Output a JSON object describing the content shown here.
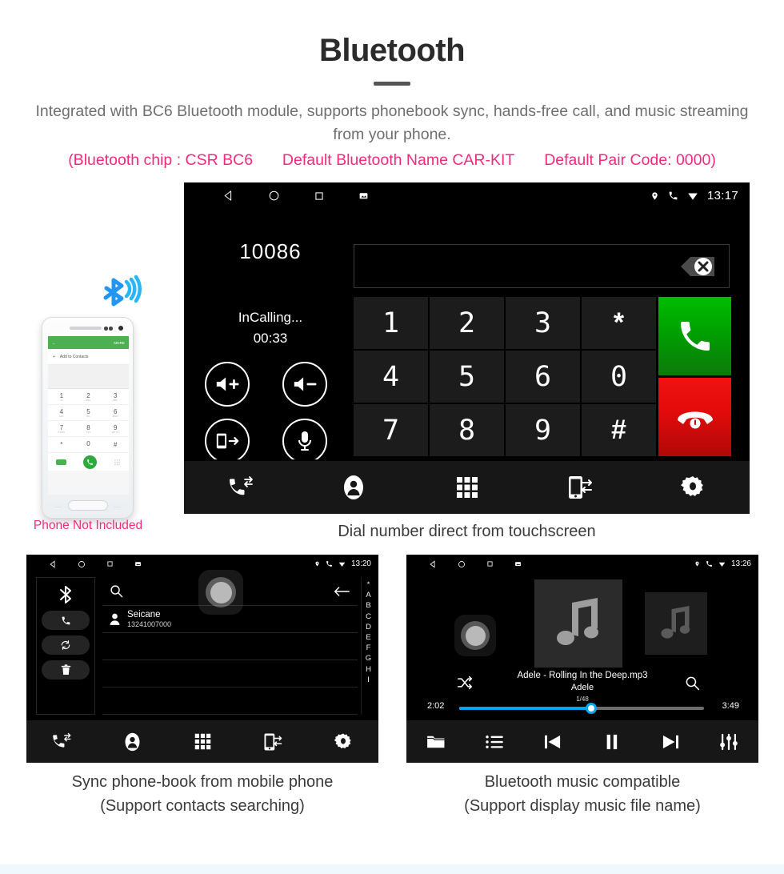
{
  "header": {
    "title": "Bluetooth",
    "subtitle": "Integrated with BC6 Bluetooth module, supports phonebook sync, hands-free call, and music streaming from your phone.",
    "spec_chip": "(Bluetooth chip : CSR BC6",
    "spec_name": "Default Bluetooth Name CAR-KIT",
    "spec_pair": "Default Pair Code: 0000)",
    "accent_pink": "#f5297e",
    "body_gray": "#6f6f6f"
  },
  "captions": {
    "main": "Dial number direct from touchscreen",
    "bottom_left_line1": "Sync phone-book from mobile phone",
    "bottom_left_line2": "(Support contacts searching)",
    "bottom_right_line1": "Bluetooth music compatible",
    "bottom_right_line2": "(Support display music file name)",
    "phone_note": "Phone Not Included"
  },
  "dialer_screen": {
    "status_bar": {
      "time": "13:17",
      "left_icons": [
        "back-icon",
        "home-icon",
        "recents-icon",
        "screenshot-icon"
      ],
      "right_icons": [
        "location-icon",
        "phone-icon",
        "wifi-icon"
      ]
    },
    "caller_number": "10086",
    "call_state": "InCalling...",
    "call_timer": "00:33",
    "input_value": "",
    "backspace_icon": "backspace-delete-icon",
    "call_controls": [
      {
        "name": "volume-up-button",
        "icon": "speaker-plus-icon"
      },
      {
        "name": "volume-down-button",
        "icon": "speaker-minus-icon"
      },
      {
        "name": "transfer-audio-button",
        "icon": "phone-transfer-icon"
      },
      {
        "name": "mute-microphone-button",
        "icon": "microphone-icon"
      }
    ],
    "keys": [
      "1",
      "2",
      "3",
      "*",
      "4",
      "5",
      "6",
      "0",
      "7",
      "8",
      "9",
      "#"
    ],
    "answer_button": {
      "icon": "handset-icon",
      "color": "#00a000"
    },
    "hangup_button": {
      "icon": "hangup-icon",
      "color": "#e00b0b"
    },
    "nav_items": [
      {
        "name": "nav-call-history",
        "icon": "call-history-icon"
      },
      {
        "name": "nav-contacts",
        "icon": "contact-person-icon"
      },
      {
        "name": "nav-dialpad",
        "icon": "dialpad-grid-icon"
      },
      {
        "name": "nav-sync-phone",
        "icon": "phone-sync-icon"
      },
      {
        "name": "nav-settings",
        "icon": "gear-icon"
      }
    ]
  },
  "phone_mockup": {
    "appbar_back": "←",
    "appbar_more": "MORE",
    "add_contacts": "Add to Contacts",
    "keys": [
      {
        "d": "1",
        "s": "oo"
      },
      {
        "d": "2",
        "s": "ABC"
      },
      {
        "d": "3",
        "s": "DEF"
      },
      {
        "d": "4",
        "s": "GHI"
      },
      {
        "d": "5",
        "s": "JKL"
      },
      {
        "d": "6",
        "s": "MNO"
      },
      {
        "d": "7",
        "s": "PQRS"
      },
      {
        "d": "8",
        "s": "TUV"
      },
      {
        "d": "9",
        "s": "WXYZ"
      },
      {
        "d": "*",
        "s": ""
      },
      {
        "d": "0",
        "s": "+"
      },
      {
        "d": "#",
        "s": ""
      }
    ],
    "bluetooth_badge_icon": "bluetooth-signal-icon",
    "bluetooth_badge_color": "#2196f3"
  },
  "phonebook_screen": {
    "status_bar": {
      "time": "13:20"
    },
    "side_buttons": [
      {
        "name": "bluetooth-status-icon",
        "icon": "bluetooth-icon"
      },
      {
        "name": "dial-contact-button",
        "icon": "handset-icon"
      },
      {
        "name": "sync-contacts-button",
        "icon": "refresh-sync-icon"
      },
      {
        "name": "delete-contacts-button",
        "icon": "trash-icon"
      }
    ],
    "search_placeholder": "",
    "search_icon": "search-icon",
    "back_icon": "arrow-left-icon",
    "contacts": [
      {
        "name": "Seicane",
        "number": "13241007000"
      }
    ],
    "empty_rows": 3,
    "index_letters": [
      "*",
      "A",
      "B",
      "C",
      "D",
      "E",
      "F",
      "G",
      "H",
      "I"
    ],
    "nav_items": [
      {
        "name": "nav-call-history",
        "icon": "call-history-icon"
      },
      {
        "name": "nav-contacts",
        "icon": "contact-person-icon"
      },
      {
        "name": "nav-dialpad",
        "icon": "dialpad-grid-icon"
      },
      {
        "name": "nav-sync-phone",
        "icon": "phone-sync-icon"
      },
      {
        "name": "nav-settings",
        "icon": "gear-icon"
      }
    ]
  },
  "music_screen": {
    "status_bar": {
      "time": "13:26"
    },
    "track_title": "Adele - Rolling In the Deep.mp3",
    "artist": "Adele",
    "track_position": "1/48",
    "time_elapsed": "2:02",
    "time_total": "3:49",
    "progress_percent": 54,
    "progress_color": "#00a7f0",
    "shuffle_icon": "shuffle-icon",
    "search_icon": "search-icon",
    "album_art_icon": "music-note-icon",
    "controls": [
      {
        "name": "browse-folder-button",
        "icon": "folder-icon"
      },
      {
        "name": "playlist-button",
        "icon": "list-icon"
      },
      {
        "name": "previous-track-button",
        "icon": "previous-icon"
      },
      {
        "name": "pause-button",
        "icon": "pause-icon"
      },
      {
        "name": "next-track-button",
        "icon": "next-icon"
      },
      {
        "name": "equalizer-button",
        "icon": "equalizer-icon"
      }
    ]
  }
}
